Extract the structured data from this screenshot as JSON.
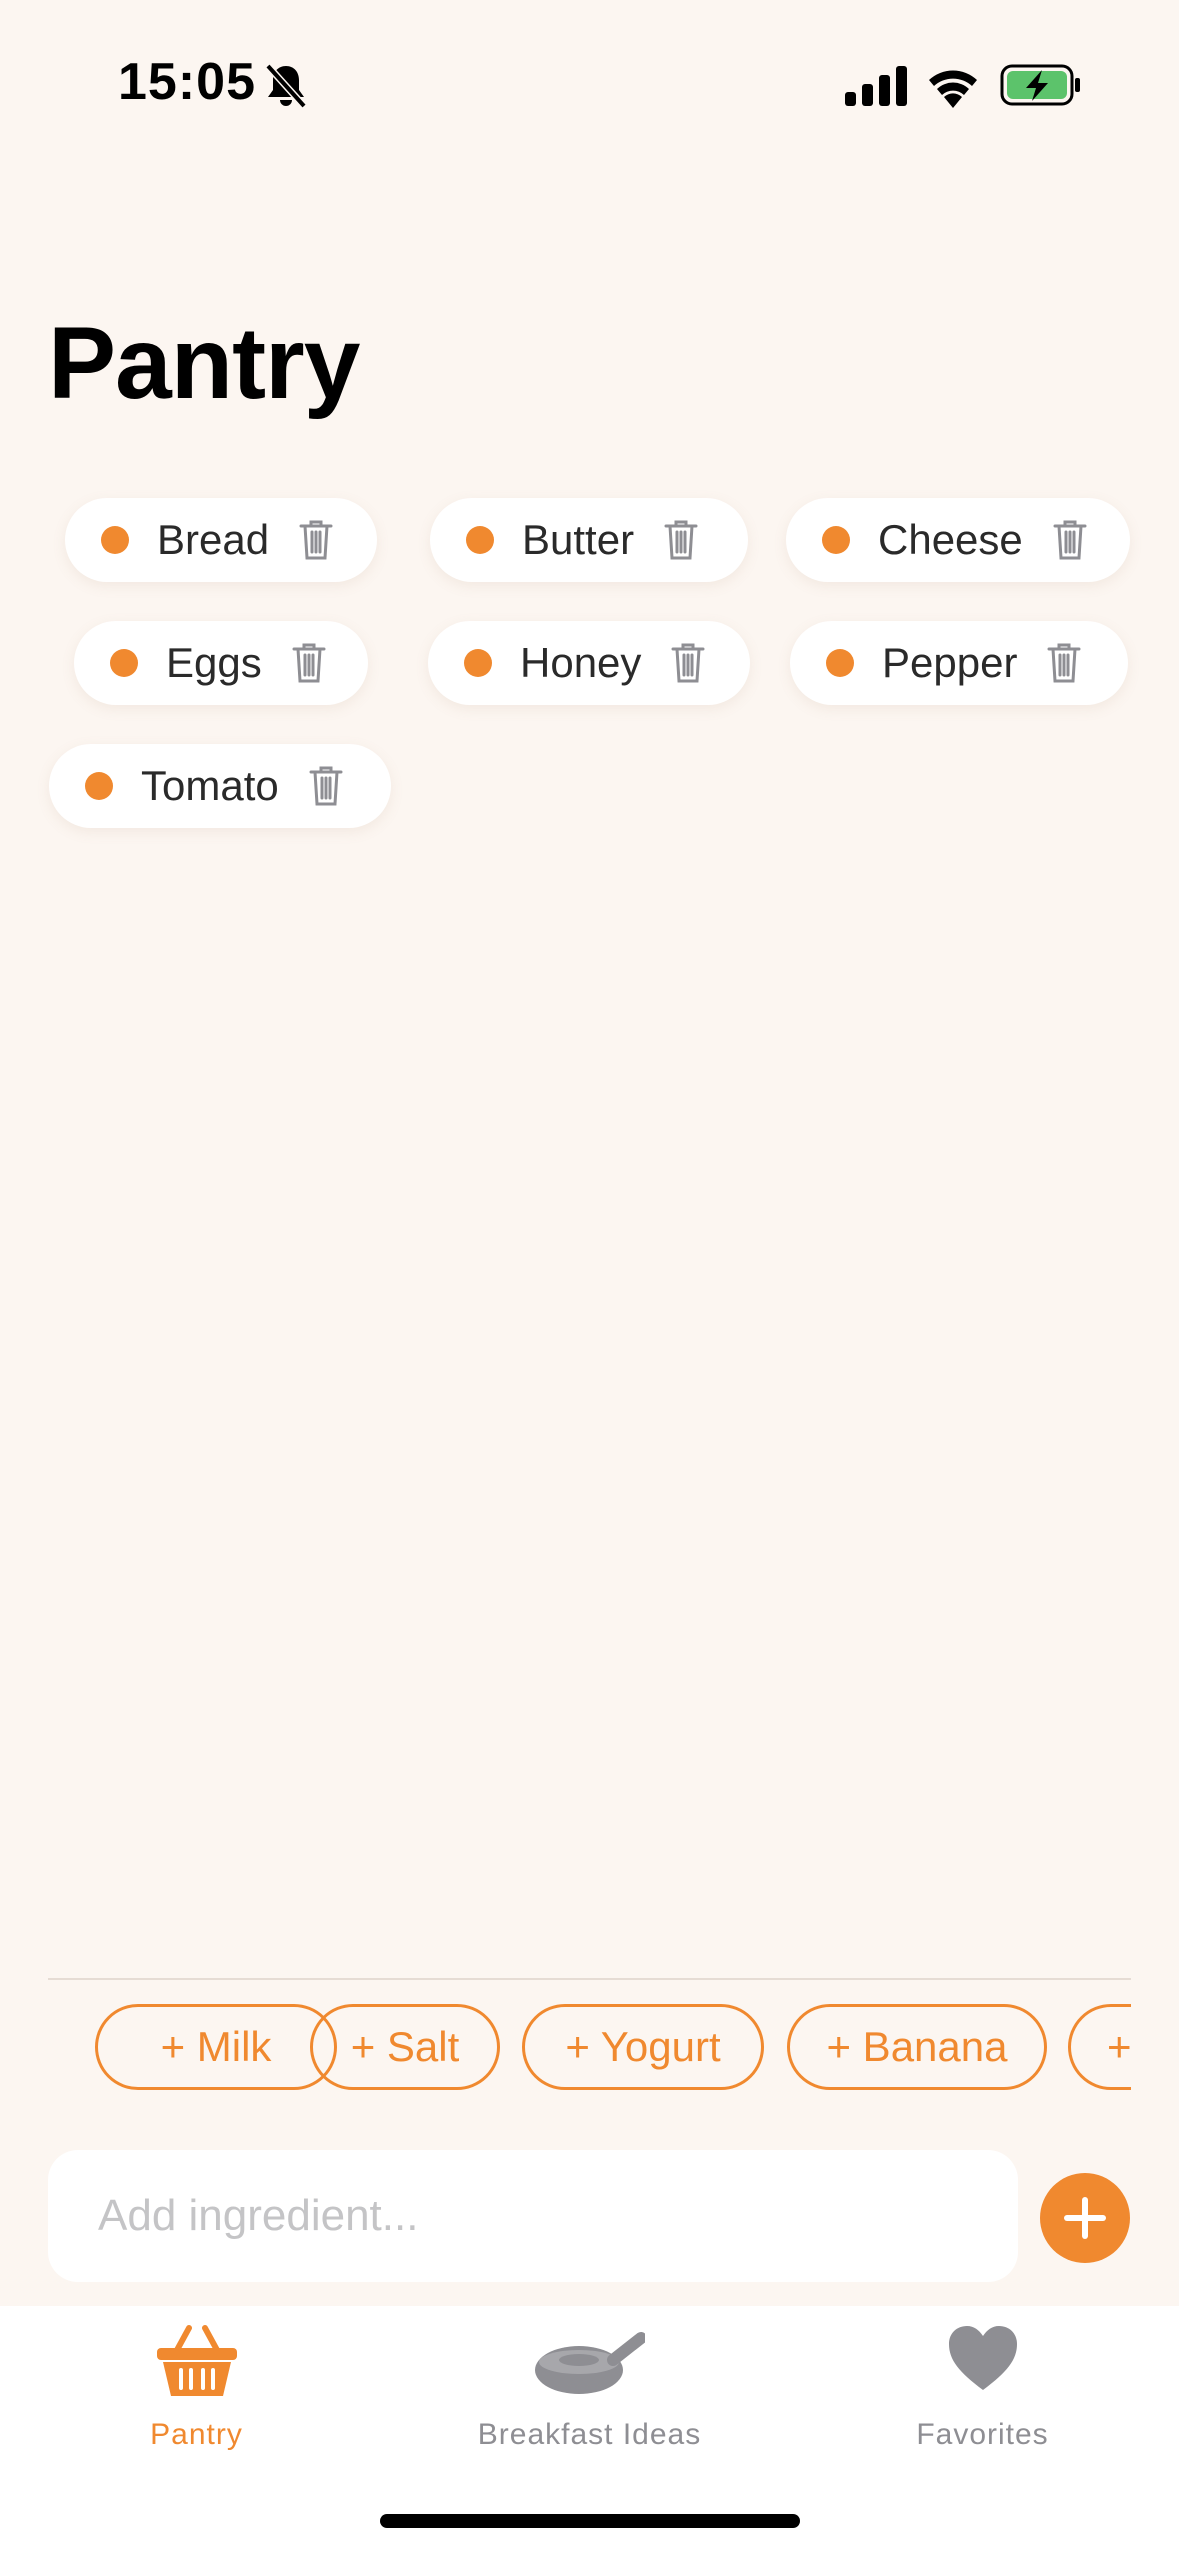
{
  "status_bar": {
    "time": "15:05",
    "icons": [
      "bell-slash-icon",
      "cellular-signal-icon",
      "wifi-icon",
      "battery-charging-icon"
    ]
  },
  "page": {
    "title": "Pantry"
  },
  "pantry_items": [
    {
      "label": "Bread"
    },
    {
      "label": "Butter"
    },
    {
      "label": "Cheese"
    },
    {
      "label": "Eggs"
    },
    {
      "label": "Honey"
    },
    {
      "label": "Pepper"
    },
    {
      "label": "Tomato"
    }
  ],
  "suggestions": [
    {
      "label": "+ Milk"
    },
    {
      "label": "+ Salt"
    },
    {
      "label": "+ Yogurt"
    },
    {
      "label": "+ Banana"
    },
    {
      "label": "+"
    }
  ],
  "input": {
    "placeholder": "Add ingredient...",
    "value": ""
  },
  "tabs": [
    {
      "label": "Pantry",
      "icon": "basket-icon",
      "active": true
    },
    {
      "label": "Breakfast Ideas",
      "icon": "frying-pan-icon",
      "active": false
    },
    {
      "label": "Favorites",
      "icon": "heart-icon",
      "active": false
    }
  ],
  "colors": {
    "accent": "#F0892F",
    "background": "#FCF6F1",
    "inactive": "#8E8E93",
    "battery_fill": "#5CC36B"
  }
}
